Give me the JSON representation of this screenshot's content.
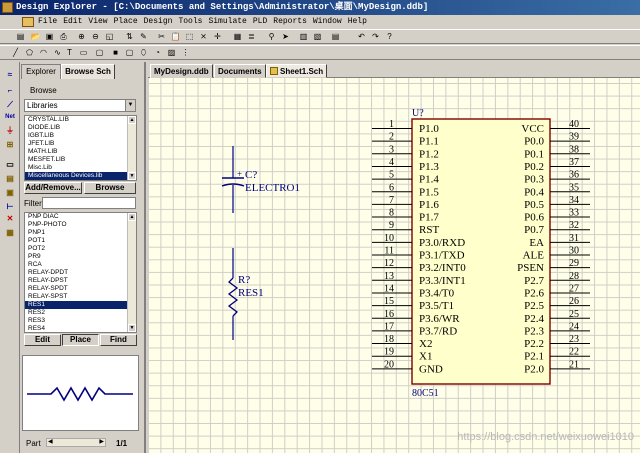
{
  "window": {
    "title": "Design Explorer - [C:\\Documents and Settings\\Administrator\\桌面\\MyDesign.ddb]"
  },
  "menu": [
    "File",
    "Edit",
    "View",
    "Place",
    "Design",
    "Tools",
    "Simulate",
    "PLD",
    "Reports",
    "Window",
    "Help"
  ],
  "panel": {
    "tabs": [
      "Explorer",
      "Browse Sch"
    ],
    "browse_label": "Browse",
    "browse_select": "Libraries",
    "libraries": [
      "CRYSTAL.LIB",
      "DIODE.LIB",
      "IGBT.LIB",
      "JFET.LIB",
      "MATH.LIB",
      "MESFET.LIB",
      "Misc.Lib",
      "Miscellaneous Devices.lib"
    ],
    "selected_library": "Miscellaneous Devices.lib",
    "add_remove_label": "Add/Remove...",
    "browse_button": "Browse",
    "filter_label": "Filter",
    "filter_value": "",
    "components": [
      "PNP DIAC",
      "PNP-PHOTO",
      "PNP1",
      "POT1",
      "POT2",
      "PR9",
      "RCA",
      "RELAY-DPDT",
      "RELAY-DPST",
      "RELAY-SPDT",
      "RELAY-SPST",
      "RES1",
      "RES2",
      "RES3",
      "RES4"
    ],
    "selected_component": "RES1",
    "edit_button": "Edit",
    "place_button": "Place",
    "find_button": "Find",
    "part_label": "Part",
    "part_page": "1/1"
  },
  "doc_tabs": [
    "MyDesign.ddb",
    "Documents",
    "Sheet1.Sch"
  ],
  "active_doc_tab": "Sheet1.Sch",
  "schematic": {
    "capacitor": {
      "designator": "C?",
      "value": "ELECTRO1",
      "polarity": "+"
    },
    "resistor": {
      "designator": "R?",
      "value": "RES1"
    },
    "chip": {
      "designator": "U?",
      "part": "80C51",
      "left_pins": [
        {
          "num": "1",
          "name": "P1.0"
        },
        {
          "num": "2",
          "name": "P1.1"
        },
        {
          "num": "3",
          "name": "P1.2"
        },
        {
          "num": "4",
          "name": "P1.3"
        },
        {
          "num": "5",
          "name": "P1.4"
        },
        {
          "num": "6",
          "name": "P1.5"
        },
        {
          "num": "7",
          "name": "P1.6"
        },
        {
          "num": "8",
          "name": "P1.7"
        },
        {
          "num": "9",
          "name": "RST"
        },
        {
          "num": "10",
          "name": "P3.0/RXD"
        },
        {
          "num": "11",
          "name": "P3.1/TXD"
        },
        {
          "num": "12",
          "name": "P3.2/INT0"
        },
        {
          "num": "13",
          "name": "P3.3/INT1"
        },
        {
          "num": "14",
          "name": "P3.4/T0"
        },
        {
          "num": "15",
          "name": "P3.5/T1"
        },
        {
          "num": "16",
          "name": "P3.6/WR"
        },
        {
          "num": "17",
          "name": "P3.7/RD"
        },
        {
          "num": "18",
          "name": "X2"
        },
        {
          "num": "19",
          "name": "X1"
        },
        {
          "num": "20",
          "name": "GND"
        }
      ],
      "right_pins": [
        {
          "num": "40",
          "name": "VCC"
        },
        {
          "num": "39",
          "name": "P0.0"
        },
        {
          "num": "38",
          "name": "P0.1"
        },
        {
          "num": "37",
          "name": "P0.2"
        },
        {
          "num": "36",
          "name": "P0.3"
        },
        {
          "num": "35",
          "name": "P0.4"
        },
        {
          "num": "34",
          "name": "P0.5"
        },
        {
          "num": "33",
          "name": "P0.6"
        },
        {
          "num": "32",
          "name": "P0.7"
        },
        {
          "num": "31",
          "name": "EA"
        },
        {
          "num": "30",
          "name": "ALE"
        },
        {
          "num": "29",
          "name": "PSEN"
        },
        {
          "num": "28",
          "name": "P2.7"
        },
        {
          "num": "27",
          "name": "P2.6"
        },
        {
          "num": "26",
          "name": "P2.5"
        },
        {
          "num": "25",
          "name": "P2.4"
        },
        {
          "num": "24",
          "name": "P2.3"
        },
        {
          "num": "23",
          "name": "P2.2"
        },
        {
          "num": "22",
          "name": "P2.1"
        },
        {
          "num": "21",
          "name": "P2.0"
        }
      ]
    }
  },
  "watermark": "https://blog.csdn.net/weixuowei1010",
  "colors": {
    "chip_border": "#800000",
    "chip_fill": "#ffffcc",
    "component_blue": "#000080",
    "sheet_bg": "#fffee8",
    "selection": "#0a246a"
  }
}
